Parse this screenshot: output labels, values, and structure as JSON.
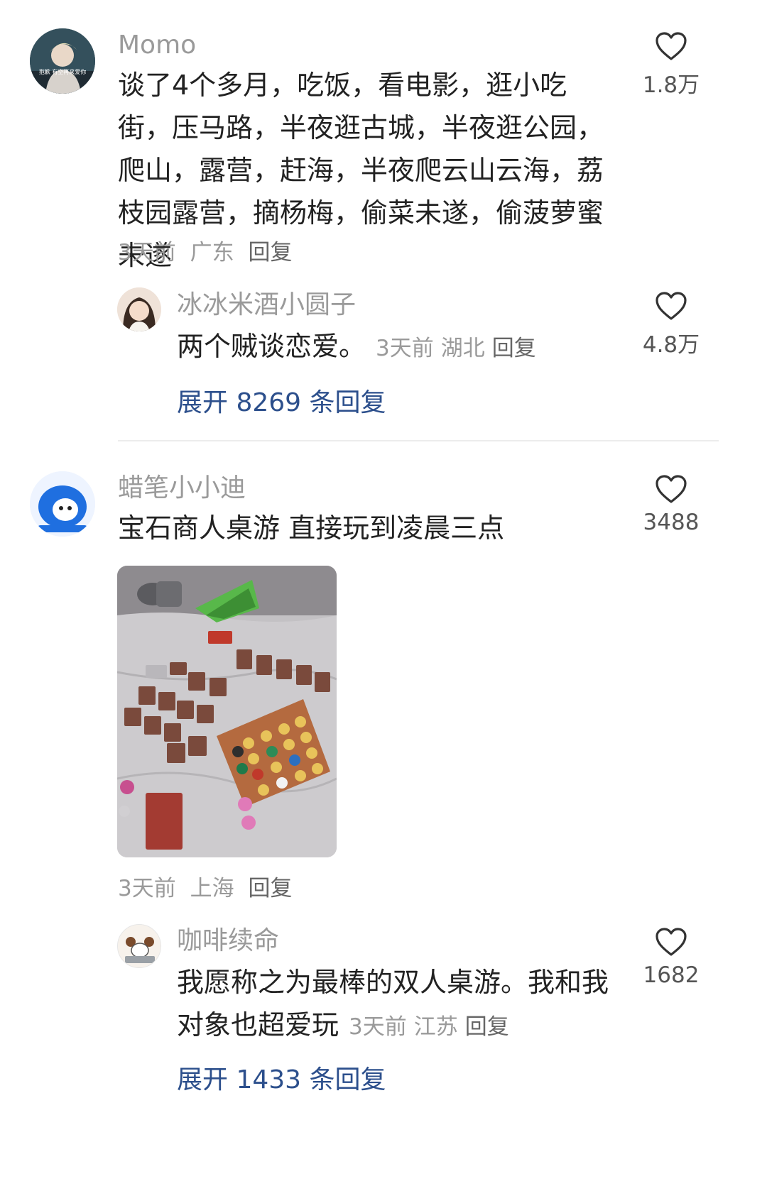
{
  "comments": [
    {
      "user": "Momo",
      "avatar_caption": "抱歉 有空再来爱你",
      "text": "谈了4个多月，吃饭，看电影，逛小吃街，压马路，半夜逛古城，半夜逛公园，爬山，露营，赶海，半夜爬云山云海，荔枝园露营，摘杨梅，偷菜未遂，偷菠萝蜜未遂",
      "time": "3天前",
      "location": "广东",
      "reply_label": "回复",
      "likes": "1.8万",
      "sub_reply": {
        "user": "冰冰米酒小圆子",
        "text": "两个贼谈恋爱。",
        "time": "3天前",
        "location": "湖北",
        "reply_label": "回复",
        "likes": "4.8万"
      },
      "expand_label": "展开 8269 条回复"
    },
    {
      "user": "蜡笔小小迪",
      "text": "宝石商人桌游 直接玩到凌晨三点",
      "time": "3天前",
      "location": "上海",
      "reply_label": "回复",
      "likes": "3488",
      "sub_reply": {
        "user": "咖啡续命",
        "text": "我愿称之为最棒的双人桌游。我和我对象也超爱玩",
        "time": "3天前",
        "location": "江苏",
        "reply_label": "回复",
        "likes": "1682"
      },
      "expand_label": "展开 1433 条回复"
    }
  ],
  "colors": {
    "name": "#9a9a9a",
    "text": "#222222",
    "expand": "#2c4f8c",
    "divider": "#ececec"
  },
  "icons": {
    "like": "heart-outline-icon"
  }
}
